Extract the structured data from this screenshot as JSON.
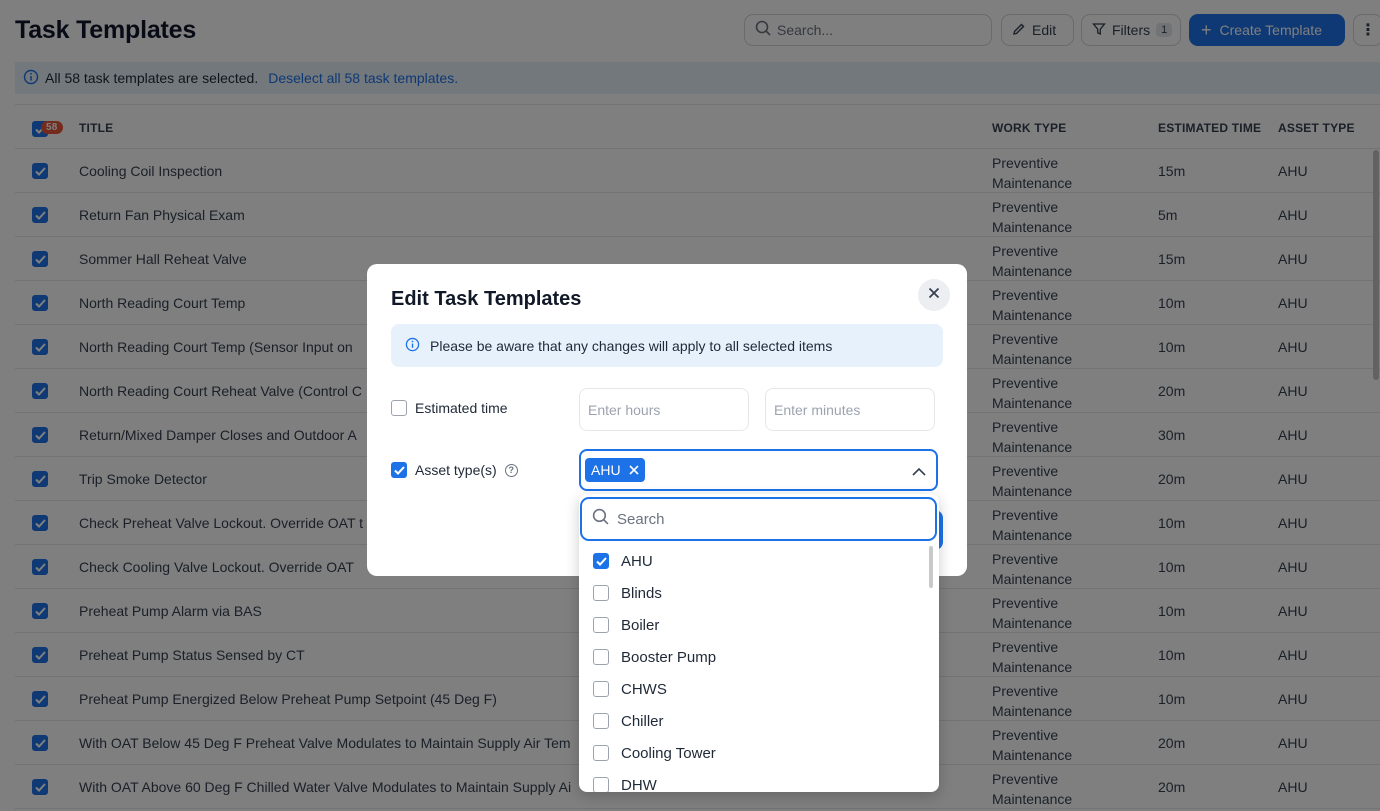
{
  "page": {
    "title": "Task Templates",
    "search_placeholder": "Search...",
    "edit_label": "Edit",
    "filters_label": "Filters",
    "filters_count": "1",
    "create_label": "Create Template",
    "banner_text": "All 58 task templates are selected.",
    "banner_link": "Deselect all 58 task templates."
  },
  "table": {
    "selected_count": "58",
    "headers": {
      "title": "TITLE",
      "work_type": "WORK TYPE",
      "estimated_time": "ESTIMATED TIME",
      "asset_type": "ASSET TYPE"
    },
    "rows": [
      {
        "title": "Cooling Coil Inspection",
        "work_type_1": "Preventive",
        "work_type_2": "Maintenance",
        "est": "15m",
        "asset": "AHU"
      },
      {
        "title": "Return Fan Physical Exam",
        "work_type_1": "Preventive",
        "work_type_2": "Maintenance",
        "est": "5m",
        "asset": "AHU"
      },
      {
        "title": "Sommer Hall Reheat Valve",
        "work_type_1": "Preventive",
        "work_type_2": "Maintenance",
        "est": "15m",
        "asset": "AHU"
      },
      {
        "title": "North Reading Court Temp",
        "work_type_1": "Preventive",
        "work_type_2": "Maintenance",
        "est": "10m",
        "asset": "AHU"
      },
      {
        "title": "North Reading Court Temp (Sensor Input on",
        "work_type_1": "Preventive",
        "work_type_2": "Maintenance",
        "est": "10m",
        "asset": "AHU"
      },
      {
        "title": "North Reading Court Reheat Valve (Control C",
        "work_type_1": "Preventive",
        "work_type_2": "Maintenance",
        "est": "20m",
        "asset": "AHU"
      },
      {
        "title": "Return/Mixed Damper Closes and Outdoor A",
        "work_type_1": "Preventive",
        "work_type_2": "Maintenance",
        "est": "30m",
        "asset": "AHU"
      },
      {
        "title": "Trip Smoke Detector",
        "work_type_1": "Preventive",
        "work_type_2": "Maintenance",
        "est": "20m",
        "asset": "AHU"
      },
      {
        "title": "Check Preheat Valve Lockout. Override OAT t",
        "work_type_1": "Preventive",
        "work_type_2": "Maintenance",
        "est": "10m",
        "asset": "AHU"
      },
      {
        "title": "Check Cooling Valve Lockout. Override OAT",
        "work_type_1": "Preventive",
        "work_type_2": "Maintenance",
        "est": "10m",
        "asset": "AHU"
      },
      {
        "title": "Preheat Pump Alarm via BAS",
        "work_type_1": "Preventive",
        "work_type_2": "Maintenance",
        "est": "10m",
        "asset": "AHU"
      },
      {
        "title": "Preheat Pump Status Sensed by CT",
        "work_type_1": "Preventive",
        "work_type_2": "Maintenance",
        "est": "10m",
        "asset": "AHU"
      },
      {
        "title": "Preheat Pump Energized Below Preheat Pump Setpoint (45 Deg F)",
        "work_type_1": "Preventive",
        "work_type_2": "Maintenance",
        "est": "10m",
        "asset": "AHU"
      },
      {
        "title": "With OAT Below 45 Deg F Preheat Valve Modulates to Maintain Supply Air Tem",
        "work_type_1": "Preventive",
        "work_type_2": "Maintenance",
        "est": "20m",
        "asset": "AHU"
      },
      {
        "title": "With OAT Above 60 Deg F Chilled Water Valve Modulates to Maintain Supply Ai",
        "work_type_1": "Preventive",
        "work_type_2": "Maintenance",
        "est": "20m",
        "asset": "AHU"
      }
    ]
  },
  "modal": {
    "title": "Edit Task Templates",
    "info": "Please be aware that any changes will apply to all selected items",
    "estimated_time_label": "Estimated time",
    "hours_placeholder": "Enter hours",
    "minutes_placeholder": "Enter minutes",
    "asset_label": "Asset type(s)",
    "selected_chip": "AHU"
  },
  "dropdown": {
    "search_placeholder": "Search",
    "options": [
      {
        "label": "AHU",
        "checked": true
      },
      {
        "label": "Blinds",
        "checked": false
      },
      {
        "label": "Boiler",
        "checked": false
      },
      {
        "label": "Booster Pump",
        "checked": false
      },
      {
        "label": "CHWS",
        "checked": false
      },
      {
        "label": "Chiller",
        "checked": false
      },
      {
        "label": "Cooling Tower",
        "checked": false
      },
      {
        "label": "DHW",
        "checked": false
      }
    ]
  },
  "colors": {
    "accent": "#1d72e8",
    "badge": "#e8573a",
    "info_bg": "#e7f1fb"
  }
}
